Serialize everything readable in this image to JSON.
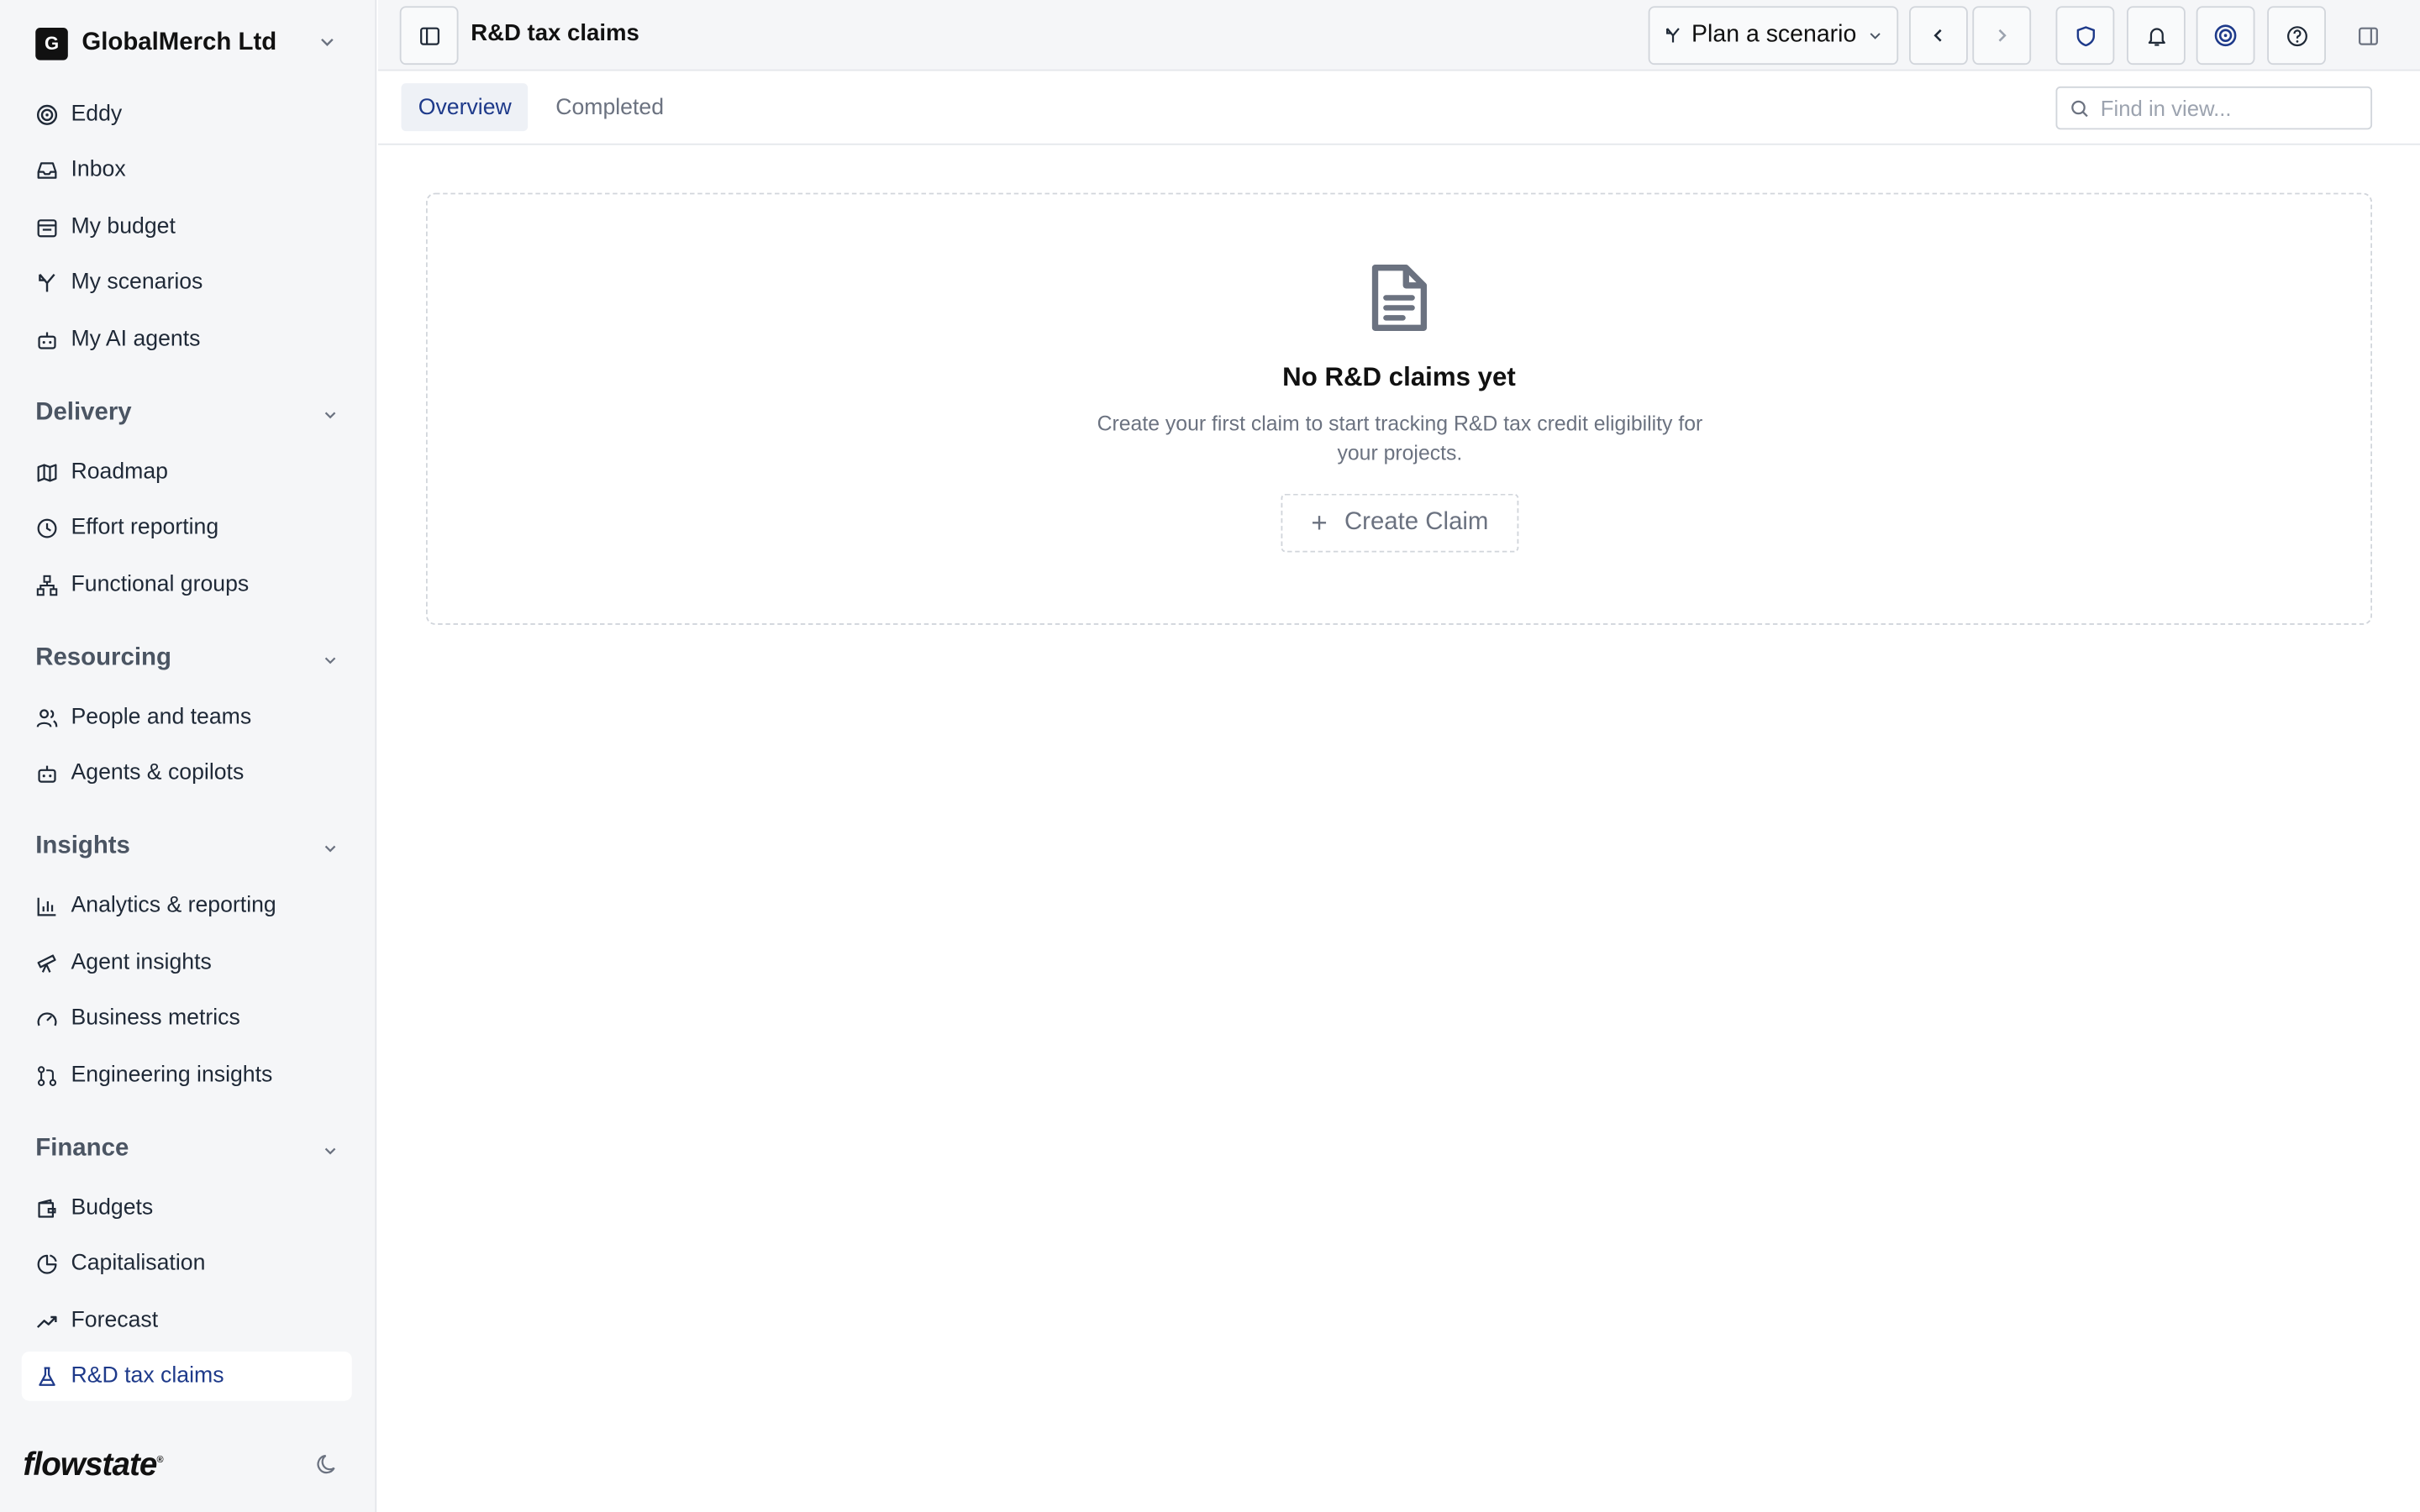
{
  "org": {
    "initial": "G",
    "name": "GlobalMerch Ltd"
  },
  "sidebar": {
    "top_items": [
      {
        "label": "Eddy",
        "icon": "swirl-icon"
      },
      {
        "label": "Inbox",
        "icon": "inbox-icon"
      },
      {
        "label": "My budget",
        "icon": "budget-icon"
      },
      {
        "label": "My scenarios",
        "icon": "branch-icon"
      },
      {
        "label": "My AI agents",
        "icon": "robot-icon"
      }
    ],
    "sections": [
      {
        "title": "Delivery",
        "items": [
          {
            "label": "Roadmap",
            "icon": "map-icon"
          },
          {
            "label": "Effort reporting",
            "icon": "clock-icon"
          },
          {
            "label": "Functional groups",
            "icon": "hierarchy-icon"
          }
        ]
      },
      {
        "title": "Resourcing",
        "items": [
          {
            "label": "People and teams",
            "icon": "people-icon"
          },
          {
            "label": "Agents & copilots",
            "icon": "robot-icon"
          }
        ]
      },
      {
        "title": "Insights",
        "items": [
          {
            "label": "Analytics & reporting",
            "icon": "bar-chart-icon"
          },
          {
            "label": "Agent insights",
            "icon": "telescope-icon"
          },
          {
            "label": "Business metrics",
            "icon": "gauge-icon"
          },
          {
            "label": "Engineering insights",
            "icon": "pull-request-icon"
          }
        ]
      },
      {
        "title": "Finance",
        "items": [
          {
            "label": "Budgets",
            "icon": "wallet-icon"
          },
          {
            "label": "Capitalisation",
            "icon": "pie-chart-icon"
          },
          {
            "label": "Forecast",
            "icon": "trend-up-icon"
          },
          {
            "label": "R&D tax claims",
            "icon": "flask-icon",
            "active": true
          }
        ]
      }
    ],
    "brand": "flowstate"
  },
  "topbar": {
    "title": "R&D tax claims",
    "scenario_label": "Plan a scenario"
  },
  "tabs": {
    "overview": "Overview",
    "completed": "Completed"
  },
  "search": {
    "placeholder": "Find in view..."
  },
  "empty_state": {
    "title": "No R&D claims yet",
    "description": "Create your first claim to start tracking R&D tax credit eligibility for your projects.",
    "button": "Create Claim"
  },
  "colors": {
    "accent": "#1e3a8a",
    "sidebar_bg": "#f5f6f8",
    "border": "#d1d5db"
  }
}
